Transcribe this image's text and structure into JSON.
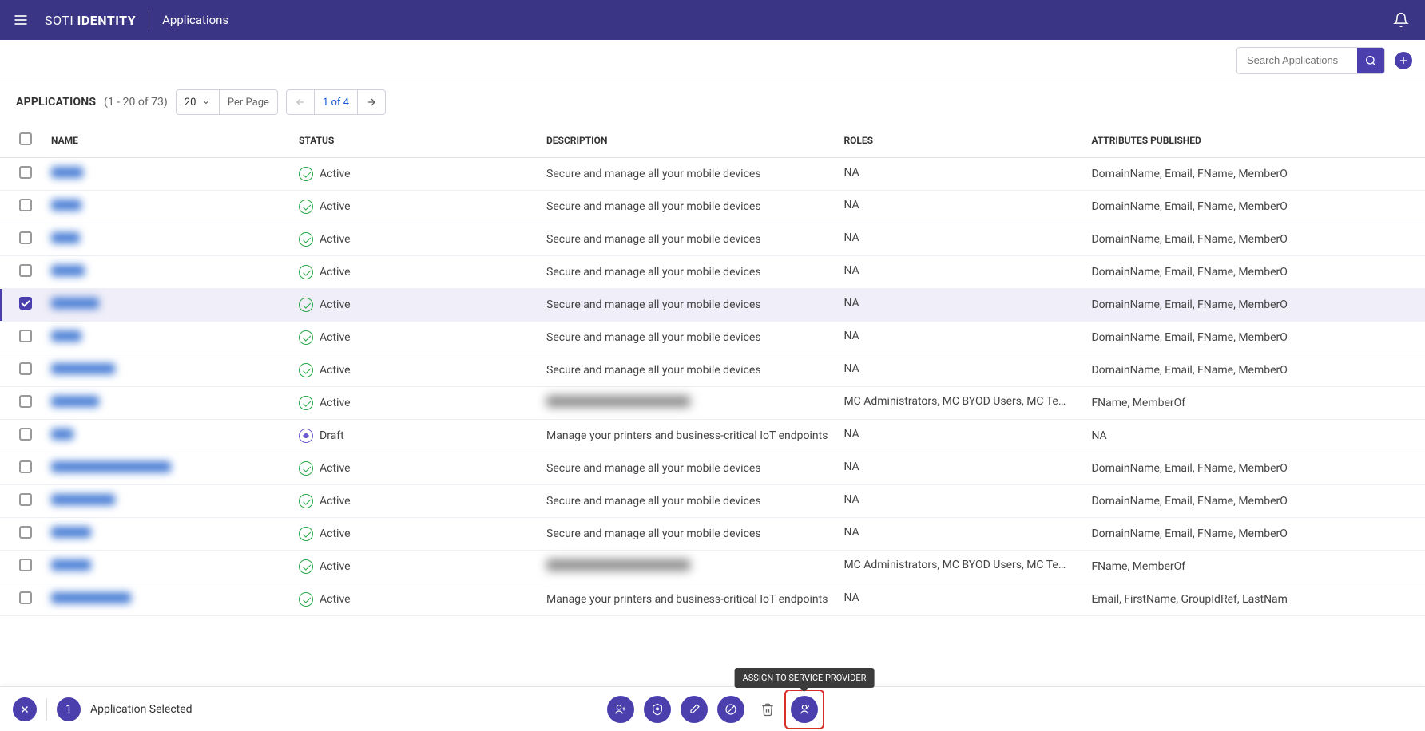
{
  "header": {
    "brand_prefix": "SOTI",
    "brand_main": "IDENTITY",
    "section": "Applications"
  },
  "search": {
    "placeholder": "Search Applications"
  },
  "page": {
    "title": "APPLICATIONS",
    "range": "(1 - 20 of 73)",
    "per_page_value": "20",
    "per_page_label": "Per Page",
    "page_info": "1 of 4"
  },
  "columns": {
    "name": "NAME",
    "status": "STATUS",
    "description": "DESCRIPTION",
    "roles": "ROLES",
    "attrs": "ATTRIBUTES PUBLISHED"
  },
  "status_labels": {
    "active": "Active",
    "draft": "Draft"
  },
  "desc_text": {
    "mobile": "Secure and manage all your mobile devices",
    "iot": "Manage your printers and business-critical IoT endpoints"
  },
  "roles_text": {
    "na": "NA",
    "mc": "MC Administrators, MC BYOD Users, MC Technicians, M…"
  },
  "attrs_text": {
    "domain": "DomainName, Email, FName, MemberO",
    "fname": "FName, MemberOf",
    "na": "NA",
    "email": "Email, FirstName, GroupIdRef, LastNam"
  },
  "rows": [
    {
      "selected": false,
      "nameW": 40,
      "status": "active",
      "desc": "mobile",
      "roles": "na",
      "attrs": "domain"
    },
    {
      "selected": false,
      "nameW": 38,
      "status": "active",
      "desc": "mobile",
      "roles": "na",
      "attrs": "domain"
    },
    {
      "selected": false,
      "nameW": 36,
      "status": "active",
      "desc": "mobile",
      "roles": "na",
      "attrs": "domain"
    },
    {
      "selected": false,
      "nameW": 42,
      "status": "active",
      "desc": "mobile",
      "roles": "na",
      "attrs": "domain"
    },
    {
      "selected": true,
      "nameW": 60,
      "status": "active",
      "desc": "mobile",
      "roles": "na",
      "attrs": "domain"
    },
    {
      "selected": false,
      "nameW": 38,
      "status": "active",
      "desc": "mobile",
      "roles": "na",
      "attrs": "domain"
    },
    {
      "selected": false,
      "nameW": 80,
      "status": "active",
      "desc": "mobile",
      "roles": "na",
      "attrs": "domain"
    },
    {
      "selected": false,
      "nameW": 60,
      "status": "active",
      "desc": "blur",
      "roles": "mc",
      "attrs": "fname"
    },
    {
      "selected": false,
      "nameW": 28,
      "status": "draft",
      "desc": "iot",
      "roles": "na",
      "attrs": "na"
    },
    {
      "selected": false,
      "nameW": 150,
      "status": "active",
      "desc": "mobile",
      "roles": "na",
      "attrs": "domain"
    },
    {
      "selected": false,
      "nameW": 80,
      "status": "active",
      "desc": "mobile",
      "roles": "na",
      "attrs": "domain"
    },
    {
      "selected": false,
      "nameW": 50,
      "status": "active",
      "desc": "mobile",
      "roles": "na",
      "attrs": "domain"
    },
    {
      "selected": false,
      "nameW": 50,
      "status": "active",
      "desc": "blur",
      "roles": "mc",
      "attrs": "fname"
    },
    {
      "selected": false,
      "nameW": 100,
      "status": "active",
      "desc": "iot",
      "roles": "na",
      "attrs": "email"
    }
  ],
  "footer": {
    "count": "1",
    "label": "Application Selected",
    "tooltip": "ASSIGN TO SERVICE PROVIDER"
  }
}
